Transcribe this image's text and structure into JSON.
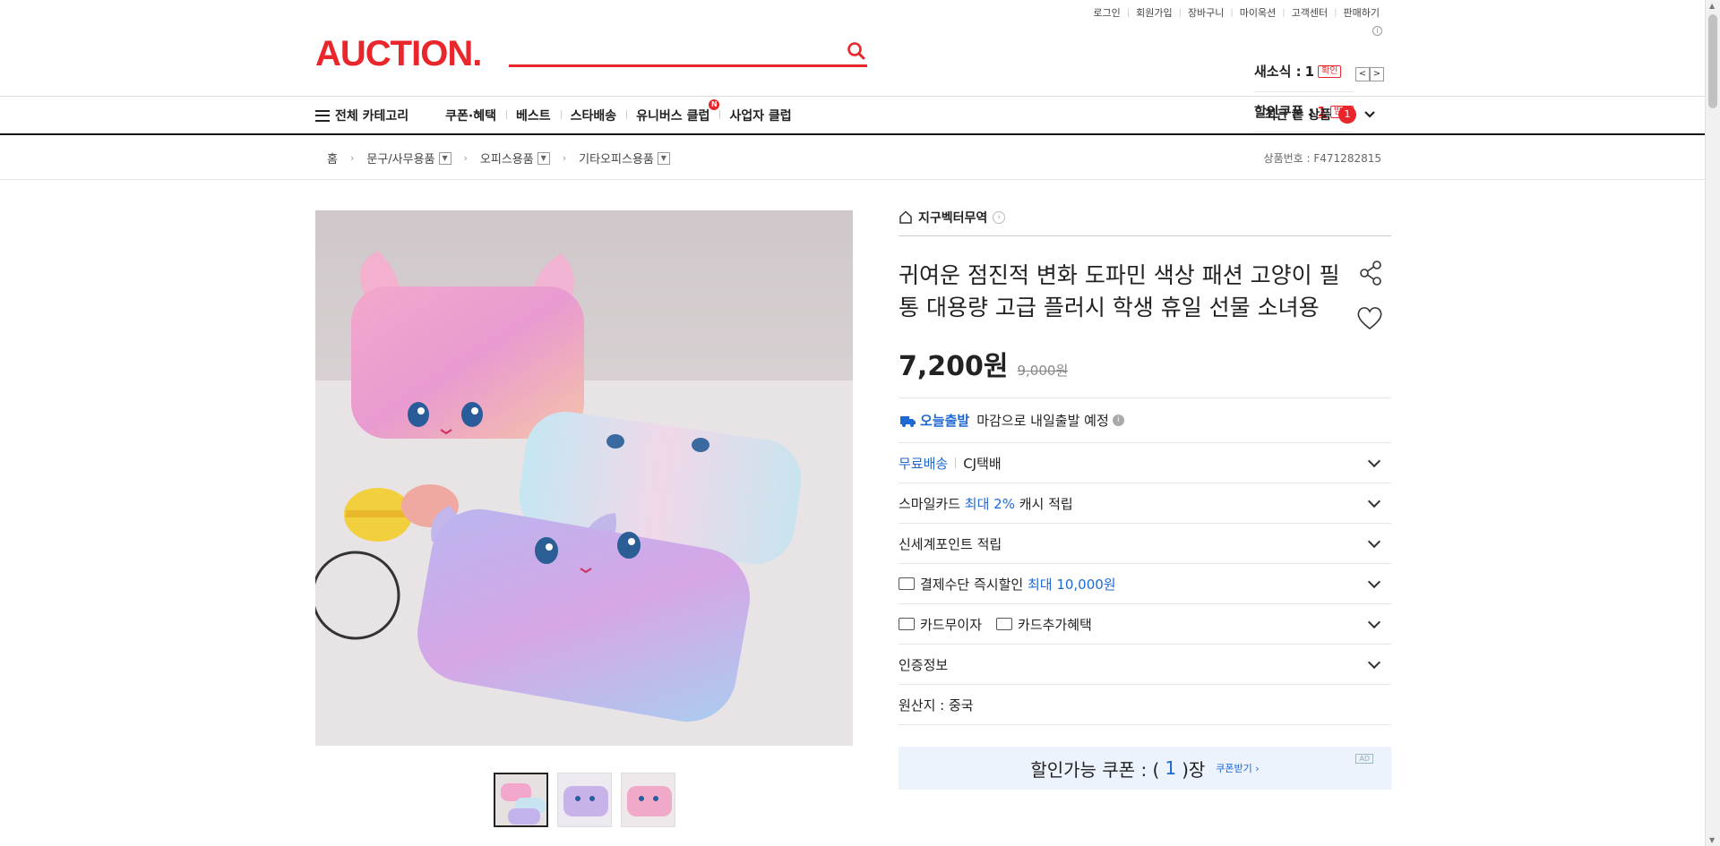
{
  "util_links": [
    "로그인",
    "회원가입",
    "장바구니",
    "마이옥션",
    "고객센터",
    "판매하기"
  ],
  "brand": {
    "logo_text": "AUCTION.",
    "accent": "#e8262b"
  },
  "search": {
    "value": "",
    "placeholder": "",
    "icon": "search-icon"
  },
  "mini_status": {
    "news_label": "새소식 :",
    "news_count": "1",
    "news_btn": "확인",
    "coupon_label": "할인쿠폰 :",
    "coupon_count": "1",
    "coupon_btn": "받기",
    "prev": "<",
    "next": ">"
  },
  "gnb": {
    "all_category": "전체 카테고리",
    "tabs": [
      "쿠폰·혜택",
      "베스트",
      "스타배송",
      "유니버스 클럽",
      "사업자 클럽"
    ],
    "new_badge": "N",
    "recent_label": "최근 본 상품",
    "recent_count": "1"
  },
  "breadcrumb": {
    "home": "홈",
    "items": [
      "문구/사무용품",
      "오피스용품",
      "기타오피스용품"
    ],
    "product_no": "상품번호 : F471282815"
  },
  "product": {
    "shop_name": "지구벡터무역",
    "title": "귀여운 점진적 변화 도파민 색상 패션 고양이 필통 대용량 고급 플러시 학생 휴일 선물 소녀용",
    "price": "7,200원",
    "original_price": "9,000원",
    "today_ship_label": "오늘출발",
    "today_ship_text": "마감으로 내일출발 예정",
    "shipping_free": "무료배송",
    "shipping_carrier": "CJ택배",
    "smile_prefix": "스마일카드",
    "smile_highlight": "최대 2%",
    "smile_suffix": "캐시 적립",
    "ssg_point": "신세계포인트 적립",
    "pay_discount_prefix": "결제수단 즉시할인",
    "pay_discount_highlight": "최대 10,000원",
    "card_interest": "카드무이자",
    "card_extra": "카드추가혜택",
    "cert_info": "인증정보",
    "origin": "원산지 : 중국",
    "coupon_prefix": "할인가능 쿠폰 : (",
    "coupon_count": "1",
    "coupon_suffix": ")장",
    "coupon_get": "쿠폰받기 ›",
    "ad_label": "AD"
  },
  "colors": {
    "link_blue": "#1e68d4",
    "price_red": "#e8262b"
  }
}
